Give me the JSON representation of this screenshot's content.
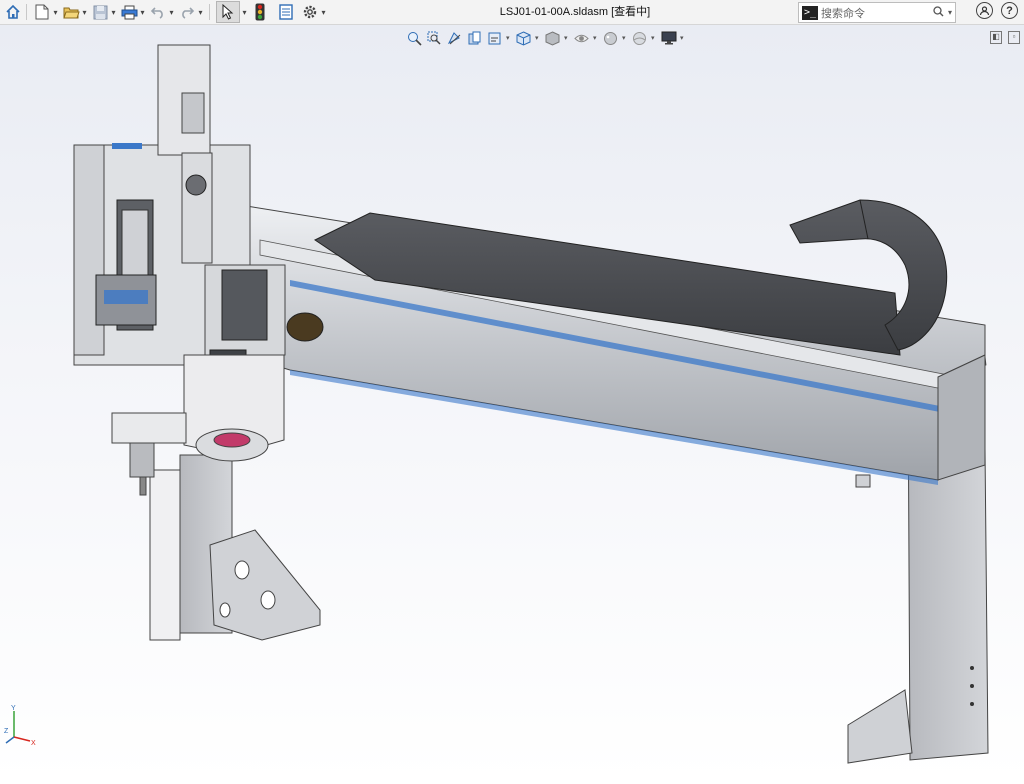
{
  "window": {
    "title": "LSJ01-01-00A.sldasm [查看中]"
  },
  "toolbar": {
    "items": [
      "home-icon",
      "new-document-icon",
      "open-folder-icon",
      "save-icon",
      "print-icon",
      "undo-icon",
      "redo-icon",
      "select-pointer-icon",
      "rebuild-traffic-light-icon",
      "file-properties-icon",
      "options-gear-icon"
    ]
  },
  "search": {
    "prompt_glyph": ">_",
    "placeholder": "搜索命令"
  },
  "help": {
    "user_icon": "user-circle-icon",
    "help_glyph": "?"
  },
  "view_toolbar": {
    "items": [
      "zoom-to-fit-icon",
      "zoom-to-area-icon",
      "previous-view-icon",
      "section-view-icon",
      "dynamic-annotation-icon",
      "view-orientation-icon",
      "display-style-icon",
      "hide-show-items-icon",
      "edit-appearance-icon",
      "apply-scene-icon",
      "view-settings-icon"
    ]
  },
  "triad": {
    "x_label": "X",
    "y_label": "Y",
    "z_label": "Z"
  },
  "colors": {
    "toolbar_bg": "#f3f3f3",
    "model_metal": "#c9cbd0",
    "model_dark": "#4b4d52",
    "accent_blue": "#3b78c9",
    "traffic_red": "#d7261e",
    "traffic_amber": "#e8b32a",
    "traffic_green": "#3aa43a"
  }
}
